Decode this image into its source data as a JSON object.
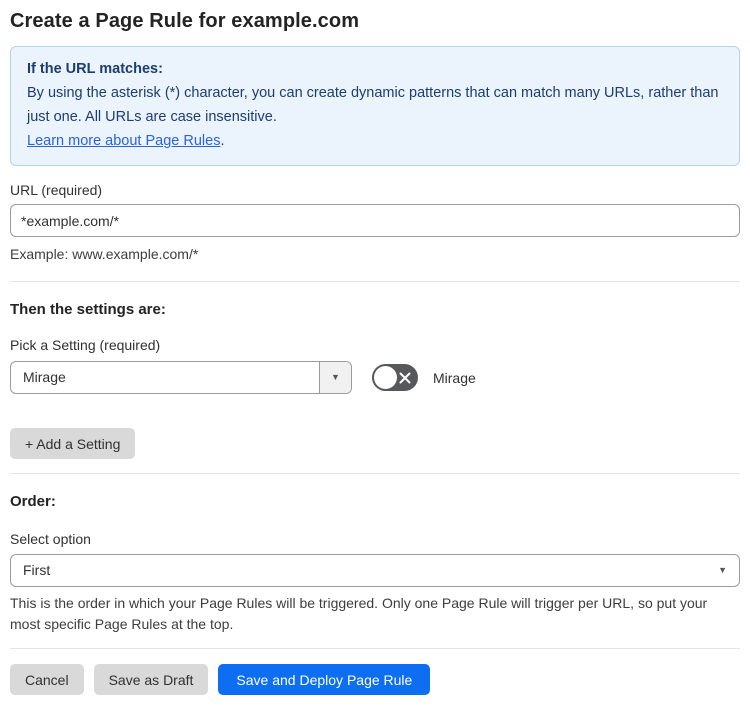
{
  "page": {
    "title": "Create a Page Rule for example.com"
  },
  "info_box": {
    "heading": "If the URL matches:",
    "body": "By using the asterisk (*) character, you can create dynamic patterns that can match many URLs, rather than just one. All URLs are case insensitive.",
    "link_label": "Learn more about Page Rules",
    "link_suffix": "."
  },
  "url_field": {
    "label": "URL (required)",
    "value": "*example.com/*",
    "helper": "Example: www.example.com/*"
  },
  "settings_section": {
    "heading": "Then the settings are:",
    "picker_label": "Pick a Setting (required)",
    "picker_value": "Mirage",
    "toggle_label": "Mirage",
    "toggle_state": "off",
    "add_setting_label": "+ Add a Setting"
  },
  "order_section": {
    "heading": "Order:",
    "select_label": "Select option",
    "select_value": "First",
    "helper": "This is the order in which your Page Rules will be triggered. Only one Page Rule will trigger per URL, so put your most specific Page Rules at the top."
  },
  "footer": {
    "cancel_label": "Cancel",
    "save_draft_label": "Save as Draft",
    "save_deploy_label": "Save and Deploy Page Rule"
  },
  "colors": {
    "accent_blue": "#0d6ef2",
    "info_bg": "#ebf3fd",
    "info_border": "#b5d3f0",
    "info_text": "#1d3d6f",
    "link_blue": "#2b63d9",
    "toggle_off_bg": "#56585c",
    "gray_button_bg": "#d9d9d9"
  }
}
